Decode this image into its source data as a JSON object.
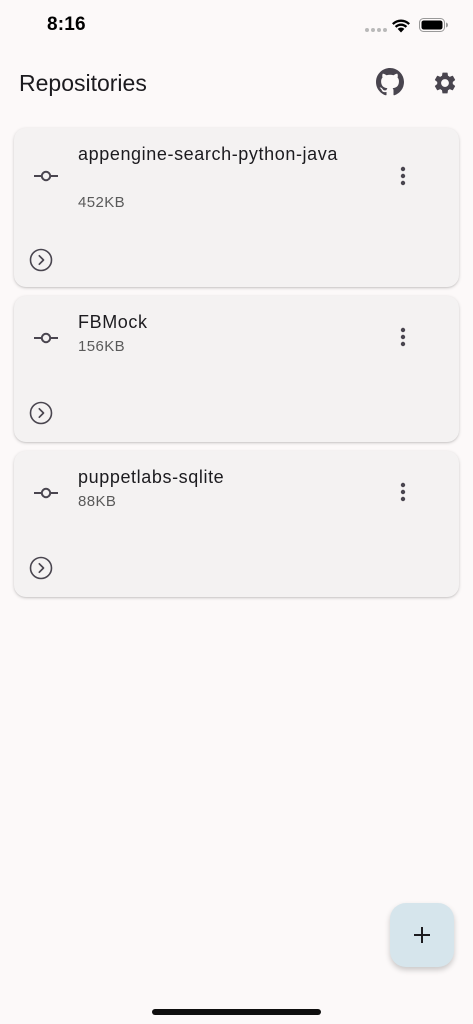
{
  "status_bar": {
    "time": "8:16"
  },
  "app_bar": {
    "title": "Repositories",
    "github_icon": "github-icon",
    "settings_icon": "gear-icon"
  },
  "repositories": [
    {
      "name": "appengine-search-python-java",
      "size": "452KB"
    },
    {
      "name": "FBMock",
      "size": "156KB"
    },
    {
      "name": "puppetlabs-sqlite",
      "size": "88KB"
    }
  ],
  "fab": {
    "icon": "plus-icon"
  },
  "colors": {
    "background": "#fcf9f9",
    "card": "#f4f2f2",
    "fab": "#d6e5ec",
    "icon": "#49454f"
  }
}
